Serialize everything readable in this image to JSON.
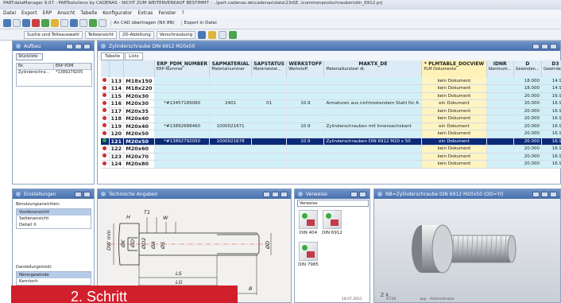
{
  "window": {
    "title": "PARTdataManager 9.07 - PARTsolutions by CADENAS - NICHT ZUM WEITERVERKAUF BESTIMMT - ..\\part.cadenas.de\\cadenas\\data\\23d\\E..\\commonpoolschrauben\\din_6912.prj"
  },
  "menu": [
    "Datei",
    "Export",
    "ERP",
    "Ansicht",
    "Tabelle",
    "Konfigurator",
    "Extras",
    "Fenster",
    "?"
  ],
  "toolbar": {
    "cad_label": "An CAD übertragen (NX 8N)",
    "export_label": "Export in Datei"
  },
  "toolbar2": {
    "items": [
      "Suche und Teileauswahl",
      "Teileansicht",
      "2D-Ableitung",
      "Verschraubung"
    ]
  },
  "aufbau": {
    "title": "Aufbau",
    "button": "Stückliste",
    "col1": "Nr.",
    "col2": "ERP PDM",
    "row_name": "Zylinderschra...",
    "row_erp": "*1389279205"
  },
  "main": {
    "title": "Zylinderschraube DIN 6912 M20x50",
    "tabs": [
      "Tabelle",
      "Lists"
    ],
    "headers": [
      {
        "top": "",
        "sub": ""
      },
      {
        "top": "",
        "sub": ""
      },
      {
        "top": "",
        "sub": ""
      },
      {
        "top": "ERP_PDM_NUMBER",
        "sub": "ERP-Nummer"
      },
      {
        "top": "SAPMATERIAL",
        "sub": "Materialnummer"
      },
      {
        "top": "SAPSTATUS",
        "sub": "Materialstat..."
      },
      {
        "top": "WERKSTOFF",
        "sub": "Werkstoff"
      },
      {
        "top": "MAKTX_DE",
        "sub": "Materialkurztext dt."
      },
      {
        "top": "* PLMTABLE_DOCVIEW",
        "sub": "PLM Dokumente"
      },
      {
        "top": "IDNR",
        "sub": "Identnum..."
      },
      {
        "top": "D",
        "sub": "Gewinden..."
      },
      {
        "top": "D3",
        "sub": "Gewindek..."
      }
    ],
    "rows": [
      {
        "status": "red",
        "nr": "113",
        "size": "M18x150",
        "erp": "",
        "mat": "",
        "stat": "",
        "werk": "",
        "text": "",
        "plm": "kein Dokument",
        "id": "",
        "d": "18.000",
        "d3": "14.933"
      },
      {
        "status": "red",
        "nr": "114",
        "size": "M18x220",
        "erp": "",
        "mat": "",
        "stat": "",
        "werk": "",
        "text": "",
        "plm": "kein Dokument",
        "id": "",
        "d": "18.000",
        "d3": "14.933"
      },
      {
        "status": "red",
        "nr": "115",
        "size": "M20x30",
        "erp": "",
        "mat": "",
        "stat": "",
        "werk": "",
        "text": "",
        "plm": "kein Dokument",
        "id": "",
        "d": "20.000",
        "d3": "16.933"
      },
      {
        "status": "red",
        "nr": "116",
        "size": "M20x30",
        "erp": "*#13457189060",
        "mat": "2401",
        "stat": "01",
        "werk": "10.9",
        "text": "Armaturen aus nichtrostendem Stahl für A",
        "plm": "ein Dokument",
        "id": "",
        "d": "20.000",
        "d3": "16.933"
      },
      {
        "status": "red",
        "nr": "117",
        "size": "M20x35",
        "erp": "",
        "mat": "",
        "stat": "",
        "werk": "",
        "text": "",
        "plm": "kein Dokument",
        "id": "",
        "d": "20.000",
        "d3": "16.933"
      },
      {
        "status": "red",
        "nr": "118",
        "size": "M20x40",
        "erp": "",
        "mat": "",
        "stat": "",
        "werk": "",
        "text": "",
        "plm": "kein Dokument",
        "id": "",
        "d": "20.000",
        "d3": "16.933"
      },
      {
        "status": "red",
        "nr": "119",
        "size": "M20x40",
        "erp": "*#13892688460",
        "mat": "1000021671",
        "stat": "",
        "werk": "10.9",
        "text": "Zylinderschrauben mit Innensechskant",
        "plm": "ein Dokument",
        "id": "",
        "d": "20.000",
        "d3": "16.933"
      },
      {
        "status": "red",
        "nr": "120",
        "size": "M20x50",
        "erp": "",
        "mat": "",
        "stat": "",
        "werk": "",
        "text": "",
        "plm": "kein Dokument",
        "id": "",
        "d": "20.000",
        "d3": "16.933"
      },
      {
        "status": "green",
        "nr": "121",
        "size": "M20x50",
        "erp": "*#13892792050",
        "mat": "1000021678",
        "stat": "",
        "werk": "10.9",
        "text": "Zylinderschrauben DIN 6912 M20 x 50",
        "plm": "ein Dokument",
        "id": "",
        "d": "20.000",
        "d3": "16.933",
        "selected": true
      },
      {
        "status": "red",
        "nr": "122",
        "size": "M20x60",
        "erp": "",
        "mat": "",
        "stat": "",
        "werk": "",
        "text": "",
        "plm": "kein Dokument",
        "id": "",
        "d": "20.000",
        "d3": "16.933"
      },
      {
        "status": "red",
        "nr": "123",
        "size": "M20x70",
        "erp": "",
        "mat": "",
        "stat": "",
        "werk": "",
        "text": "",
        "plm": "kein Dokument",
        "id": "",
        "d": "20.000",
        "d3": "16.933"
      },
      {
        "status": "red",
        "nr": "124",
        "size": "M20x80",
        "erp": "",
        "mat": "",
        "stat": "",
        "werk": "",
        "text": "",
        "plm": "kein Dokument",
        "id": "",
        "d": "20.000",
        "d3": "16.933"
      }
    ]
  },
  "einstellungen": {
    "title": "Einstellungen",
    "label1": "Benutzungsansichten:",
    "views": [
      "Vorderansicht",
      "Seitenansicht",
      "Detail X"
    ],
    "label2": "Darstellungsmodi:",
    "modes": [
      "Nenngewinde",
      "Kernloch"
    ]
  },
  "tech": {
    "title": "Technische Angaben",
    "dims": [
      "T1",
      "W",
      "ØK",
      "ØD",
      "ØD2",
      "ØA",
      "ØS",
      "ØD",
      "LS",
      "LG",
      "L",
      "B",
      "DW min",
      "H"
    ]
  },
  "verweise": {
    "title": "Verweise",
    "select": "Verweise",
    "items": [
      "DIN 404",
      "DIN 6912",
      "DIN 7985"
    ]
  },
  "nb": {
    "title": "NB=Zylinderschraube DIN 6912 M20x50 (OD=YI)",
    "axis": "Z X"
  },
  "status": {
    "date": "18.07.2011",
    "code": "#728",
    "user": "app - Administrator"
  },
  "banner": {
    "text": "2. Schritt"
  }
}
